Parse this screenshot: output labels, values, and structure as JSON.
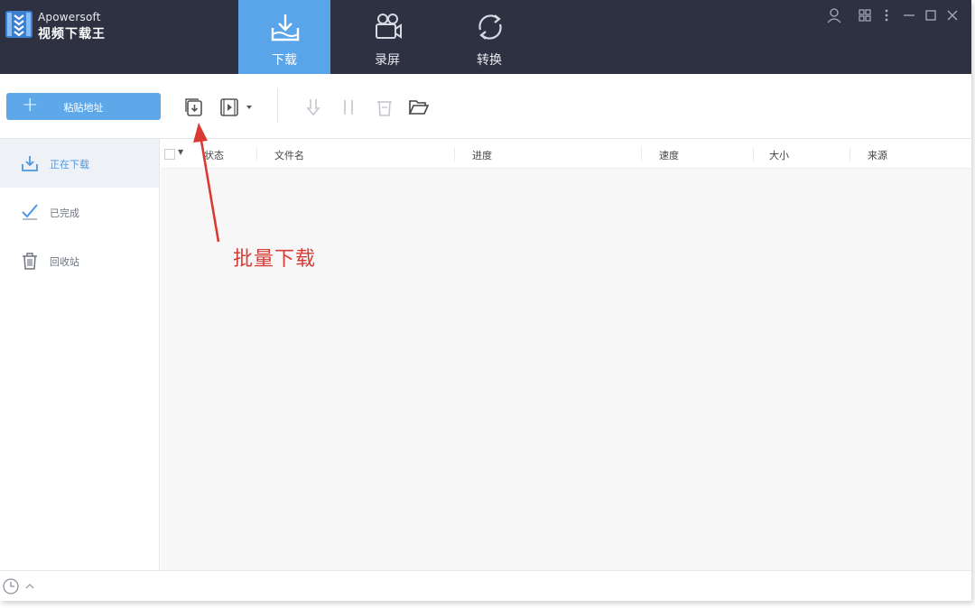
{
  "app": {
    "brand_en": "Apowersoft",
    "brand_cn": "视频下载王"
  },
  "tabs": [
    {
      "label": "下载",
      "icon": "download-tray-icon",
      "active": true
    },
    {
      "label": "录屏",
      "icon": "video-camera-icon",
      "active": false
    },
    {
      "label": "转换",
      "icon": "convert-cycle-icon",
      "active": false
    }
  ],
  "window_controls": [
    "user-icon",
    "apps-grid-icon",
    "more-vertical-icon",
    "minimize-icon",
    "maximize-icon",
    "close-icon"
  ],
  "toolbar": {
    "paste_label": "粘贴地址",
    "tools": [
      "batch-download-icon",
      "video-play-dropdown-icon",
      "priority-download-icon",
      "pause-icon",
      "delete-icon",
      "open-folder-icon"
    ]
  },
  "sidebar": {
    "items": [
      {
        "label": "正在下载",
        "icon": "download-icon",
        "active": true
      },
      {
        "label": "已完成",
        "icon": "check-icon",
        "active": false
      },
      {
        "label": "回收站",
        "icon": "trash-icon",
        "active": false
      }
    ]
  },
  "table": {
    "columns": [
      "状态",
      "文件名",
      "进度",
      "速度",
      "大小",
      "来源"
    ]
  },
  "annotation": {
    "text": "批量下载"
  },
  "colors": {
    "titlebar": "#2d3142",
    "accent": "#5aa5ea",
    "annotation": "#d83a34"
  }
}
